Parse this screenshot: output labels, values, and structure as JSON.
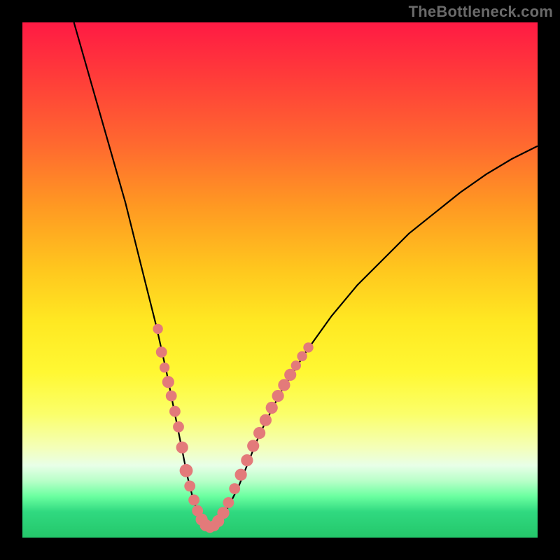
{
  "watermark": "TheBottleneck.com",
  "colors": {
    "frame": "#000000",
    "curve": "#000000",
    "dot_fill": "#e37a7a",
    "dot_stroke": "#c85a5a"
  },
  "chart_data": {
    "type": "line",
    "title": "",
    "xlabel": "",
    "ylabel": "",
    "xlim": [
      0,
      100
    ],
    "ylim": [
      0,
      100
    ],
    "series": [
      {
        "name": "bottleneck-curve",
        "x": [
          10,
          12,
          14,
          16,
          18,
          20,
          22,
          24,
          26,
          28,
          30,
          31,
          32,
          33,
          34,
          35,
          36,
          37,
          38,
          40,
          42,
          44,
          46,
          50,
          55,
          60,
          65,
          70,
          75,
          80,
          85,
          90,
          95,
          100
        ],
        "y": [
          100,
          93,
          86,
          79,
          72,
          65,
          57,
          49,
          41,
          32,
          22,
          17,
          12,
          8,
          5,
          3,
          2,
          2,
          3,
          6,
          10,
          15,
          20,
          28,
          36,
          43,
          49,
          54,
          59,
          63,
          67,
          70.5,
          73.5,
          76
        ]
      }
    ],
    "markers": [
      {
        "x": 26.3,
        "y": 40.5,
        "r": 1.0
      },
      {
        "x": 27.0,
        "y": 36.0,
        "r": 1.1
      },
      {
        "x": 27.6,
        "y": 33.0,
        "r": 1.0
      },
      {
        "x": 28.3,
        "y": 30.2,
        "r": 1.2
      },
      {
        "x": 28.9,
        "y": 27.5,
        "r": 1.1
      },
      {
        "x": 29.6,
        "y": 24.5,
        "r": 1.1
      },
      {
        "x": 30.3,
        "y": 21.5,
        "r": 1.1
      },
      {
        "x": 31.0,
        "y": 17.5,
        "r": 1.2
      },
      {
        "x": 31.8,
        "y": 13.0,
        "r": 1.3
      },
      {
        "x": 32.5,
        "y": 10.0,
        "r": 1.1
      },
      {
        "x": 33.3,
        "y": 7.3,
        "r": 1.1
      },
      {
        "x": 34.0,
        "y": 5.2,
        "r": 1.1
      },
      {
        "x": 34.8,
        "y": 3.5,
        "r": 1.2
      },
      {
        "x": 35.6,
        "y": 2.4,
        "r": 1.2
      },
      {
        "x": 36.4,
        "y": 2.0,
        "r": 1.1
      },
      {
        "x": 37.2,
        "y": 2.3,
        "r": 1.1
      },
      {
        "x": 38.0,
        "y": 3.2,
        "r": 1.2
      },
      {
        "x": 39.0,
        "y": 4.8,
        "r": 1.2
      },
      {
        "x": 40.0,
        "y": 6.8,
        "r": 1.1
      },
      {
        "x": 41.2,
        "y": 9.5,
        "r": 1.1
      },
      {
        "x": 42.4,
        "y": 12.2,
        "r": 1.2
      },
      {
        "x": 43.6,
        "y": 15.0,
        "r": 1.2
      },
      {
        "x": 44.8,
        "y": 17.8,
        "r": 1.2
      },
      {
        "x": 46.0,
        "y": 20.3,
        "r": 1.2
      },
      {
        "x": 47.2,
        "y": 22.8,
        "r": 1.2
      },
      {
        "x": 48.4,
        "y": 25.2,
        "r": 1.2
      },
      {
        "x": 49.6,
        "y": 27.5,
        "r": 1.2
      },
      {
        "x": 50.8,
        "y": 29.6,
        "r": 1.2
      },
      {
        "x": 52.0,
        "y": 31.6,
        "r": 1.2
      },
      {
        "x": 53.1,
        "y": 33.4,
        "r": 1.0
      },
      {
        "x": 54.3,
        "y": 35.2,
        "r": 1.0
      },
      {
        "x": 55.5,
        "y": 36.9,
        "r": 1.0
      }
    ]
  }
}
